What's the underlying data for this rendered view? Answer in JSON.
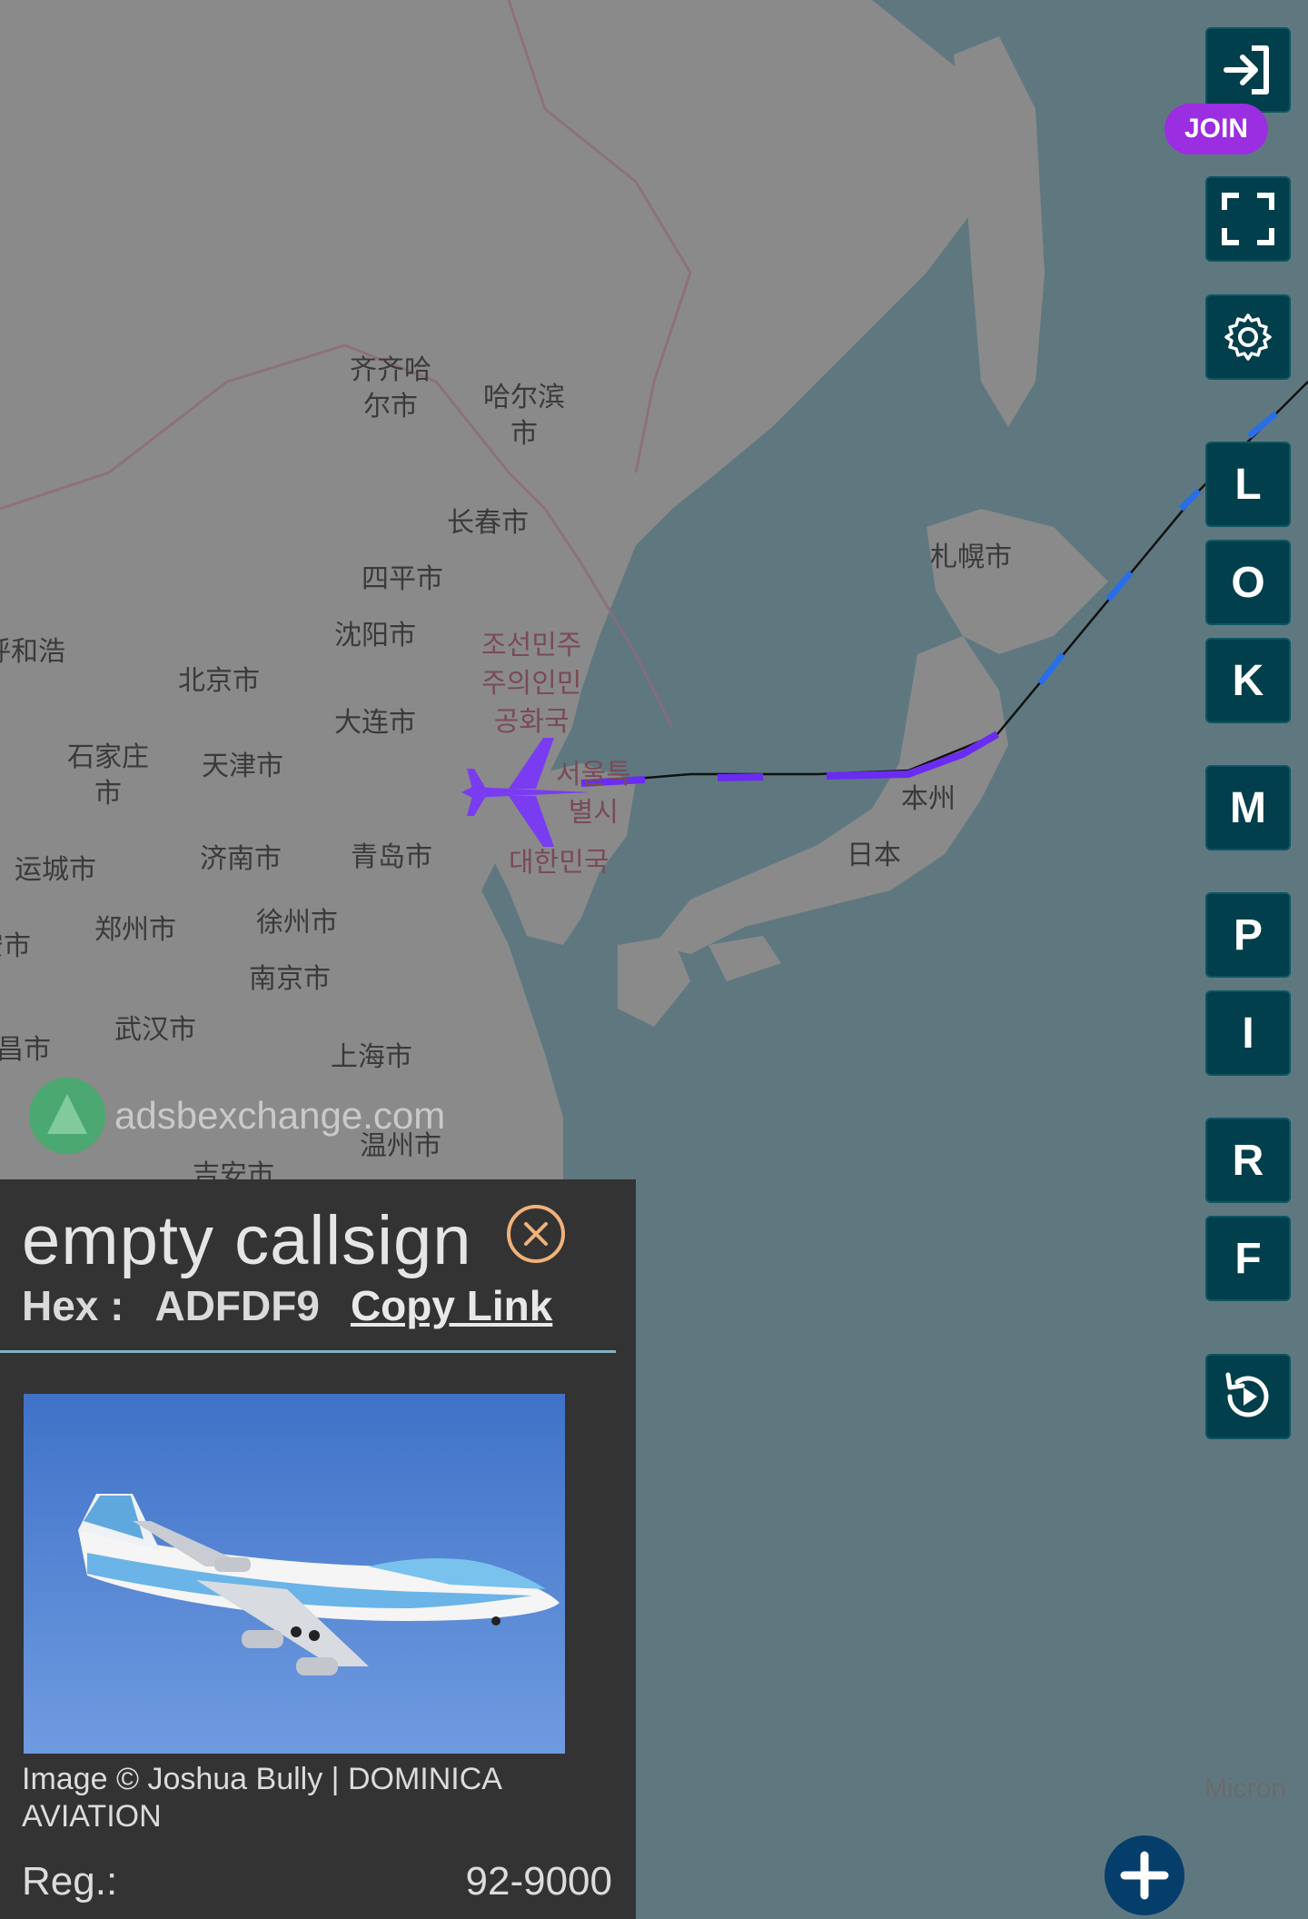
{
  "map": {
    "places": [
      {
        "name": "齐齐哈\n尔市"
      },
      {
        "name": "哈尔滨\n市"
      },
      {
        "name": "长春市"
      },
      {
        "name": "四平市"
      },
      {
        "name": "沈阳市"
      },
      {
        "name": "北京市"
      },
      {
        "name": "天津市"
      },
      {
        "name": "大连市"
      },
      {
        "name": "石家庄\n市"
      },
      {
        "name": "济南市"
      },
      {
        "name": "青岛市"
      },
      {
        "name": "运城市"
      },
      {
        "name": "郑州市"
      },
      {
        "name": "徐州市"
      },
      {
        "name": "南京市"
      },
      {
        "name": "武汉市"
      },
      {
        "name": "上海市"
      },
      {
        "name": "温州市"
      },
      {
        "name": "吉安市"
      },
      {
        "name": "呼和浩"
      },
      {
        "name": "昌市"
      },
      {
        "name": "安市"
      },
      {
        "name": "조선민주\n주의인민\n공화국",
        "kr": true
      },
      {
        "name": "서울특\n별시",
        "kr": true
      },
      {
        "name": "대한민국",
        "kr": true
      },
      {
        "name": "札幌市"
      },
      {
        "name": "本州"
      },
      {
        "name": "日本"
      },
      {
        "name": "Micron"
      }
    ],
    "watermark": "adsbexchange.com",
    "colors": {
      "sea": "#5f7880",
      "land": "#8b8b8b",
      "track_purple": "#6a2cf0",
      "track_blue": "#2a6ee6",
      "aircraft": "#7a3cf0"
    }
  },
  "controls": {
    "join_label": "JOIN",
    "buttons": [
      "L",
      "O",
      "K",
      "M",
      "P",
      "I",
      "R",
      "F"
    ],
    "icons": [
      "login-icon",
      "fullscreen-icon",
      "gear-icon",
      "replay-icon",
      "plus-icon"
    ]
  },
  "panel": {
    "callsign": "empty callsign",
    "hex_label": "Hex :",
    "hex_value": "ADFDF9",
    "copy_link": "Copy Link",
    "photo_credit": "Image © Joshua Bully | DOMINICA AVIATION",
    "reg_label": "Reg.:",
    "reg_value": "92-9000"
  }
}
